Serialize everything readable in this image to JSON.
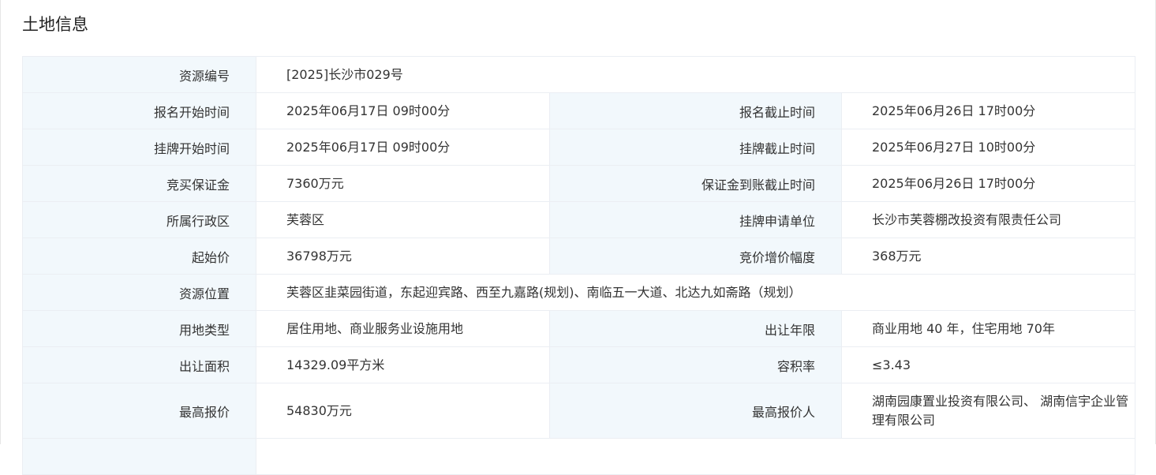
{
  "section": {
    "title": "土地信息"
  },
  "rows": {
    "resource_no": {
      "label": "资源编号",
      "value": "[2025]长沙市029号"
    },
    "signup_start": {
      "label": "报名开始时间",
      "value": "2025年06月17日 09时00分"
    },
    "signup_end": {
      "label": "报名截止时间",
      "value": "2025年06月26日 17时00分"
    },
    "listing_start": {
      "label": "挂牌开始时间",
      "value": "2025年06月17日 09时00分"
    },
    "listing_end": {
      "label": "挂牌截止时间",
      "value": "2025年06月27日 10时00分"
    },
    "deposit": {
      "label": "竞买保证金",
      "value": "7360万元"
    },
    "deposit_deadline": {
      "label": "保证金到账截止时间",
      "value": "2025年06月26日 17时00分"
    },
    "district": {
      "label": "所属行政区",
      "value": "芙蓉区"
    },
    "applicant": {
      "label": "挂牌申请单位",
      "value": "长沙市芙蓉棚改投资有限责任公司"
    },
    "start_price": {
      "label": "起始价",
      "value": "36798万元"
    },
    "increment": {
      "label": "竞价增价幅度",
      "value": "368万元"
    },
    "location": {
      "label": "资源位置",
      "value": "芙蓉区韭菜园街道，东起迎宾路、西至九嘉路(规划)、南临五一大道、北达九如斋路（规划）"
    },
    "land_use": {
      "label": "用地类型",
      "value": "居住用地、商业服务业设施用地"
    },
    "term": {
      "label": "出让年限",
      "value": "商业用地 40 年，住宅用地 70年"
    },
    "area": {
      "label": "出让面积",
      "value": "14329.09平方米"
    },
    "far": {
      "label": "容积率",
      "value": "≤3.43"
    },
    "top_bid": {
      "label": "最高报价",
      "value": "54830万元"
    },
    "top_bidder": {
      "label": "最高报价人",
      "value": "湖南园康置业投资有限公司、 湖南信宇企业管理有限公司"
    }
  }
}
